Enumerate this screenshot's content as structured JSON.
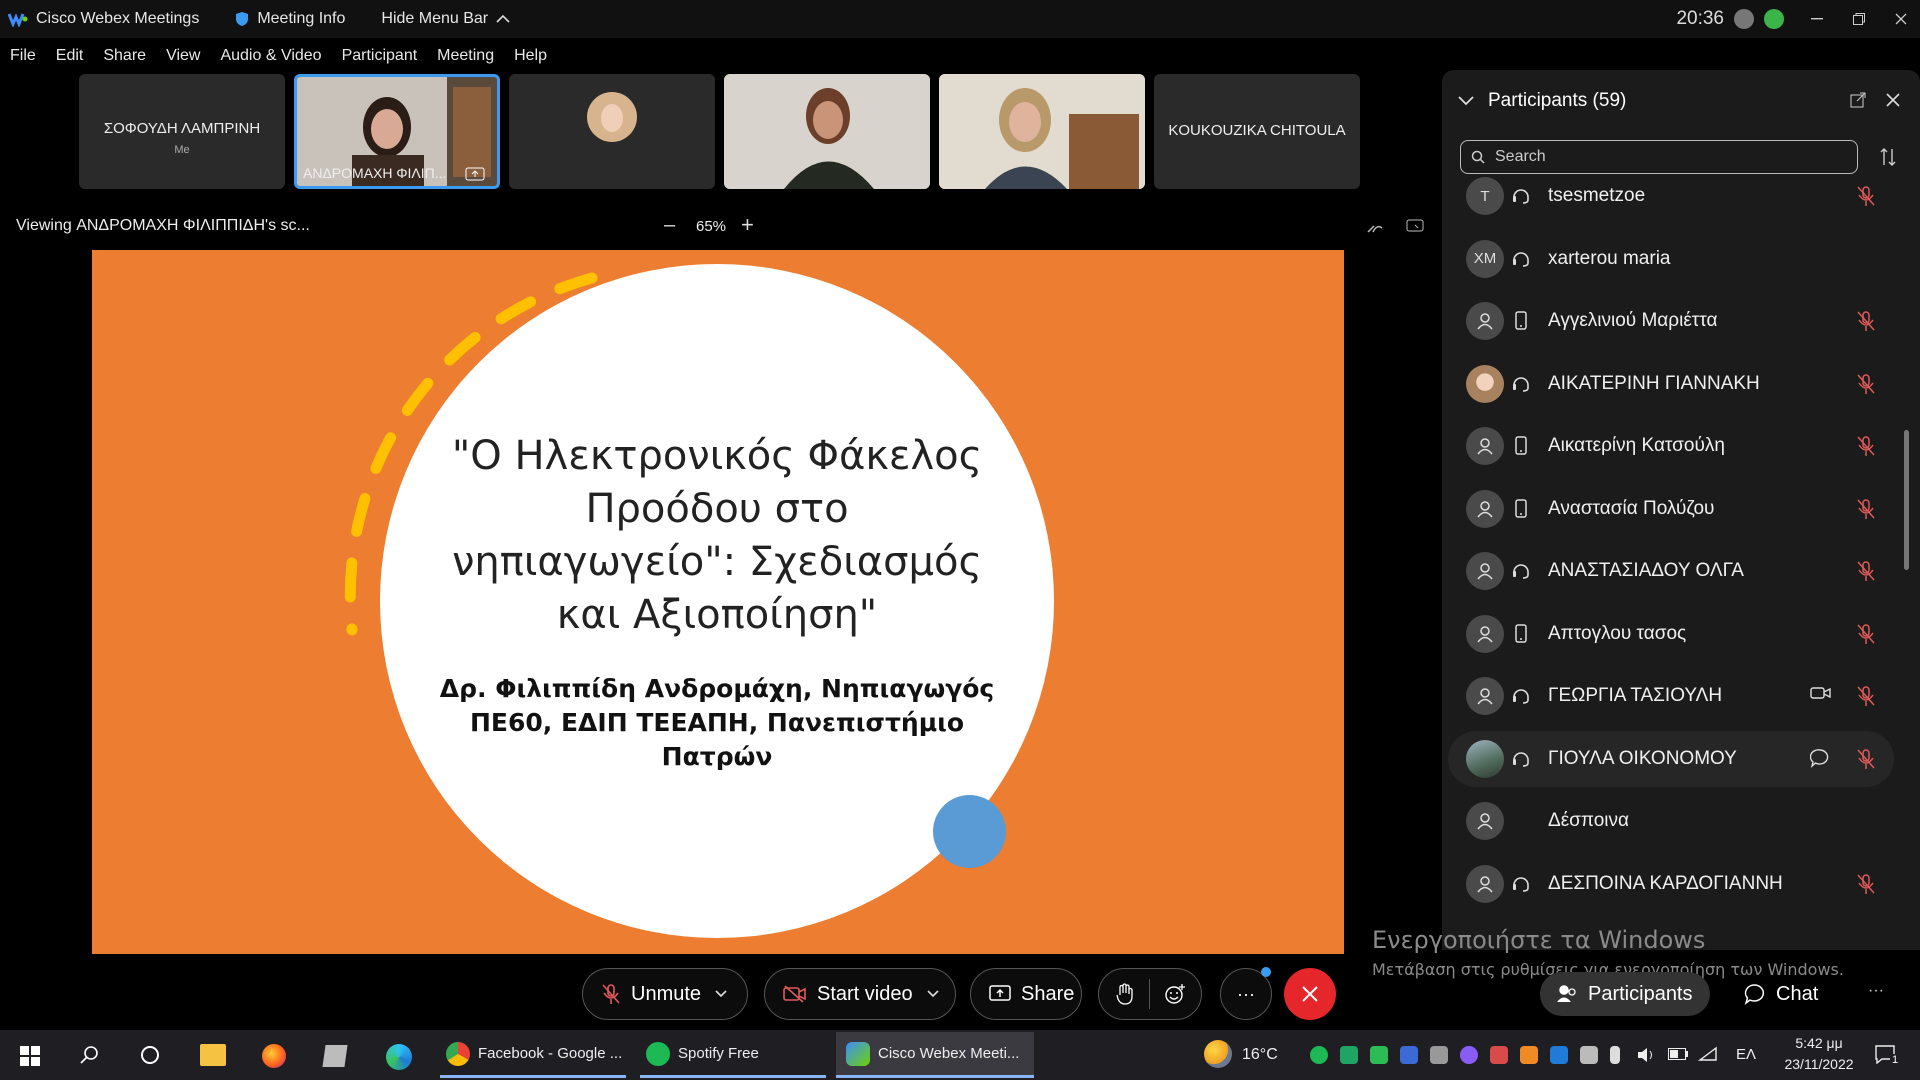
{
  "titlebar": {
    "app_name": "Cisco Webex Meetings",
    "meeting_info": "Meeting Info",
    "hide_menu_bar": "Hide Menu Bar",
    "clock": "20:36"
  },
  "menu": [
    "File",
    "Edit",
    "Share",
    "View",
    "Audio & Video",
    "Participant",
    "Meeting",
    "Help"
  ],
  "video_strip": [
    {
      "name": "ΣΟΦΟΥΔΗ ΛΑΜΠΡΙΝΗ",
      "sub": "Me"
    },
    {
      "name": "ΑΝΔΡΟΜΑΧΗ ΦΙΛΙΠ...",
      "sub": ""
    },
    {
      "name": "",
      "sub": ""
    },
    {
      "name": "",
      "sub": ""
    },
    {
      "name": "",
      "sub": ""
    },
    {
      "name": "KOUKOUZIKA CHITOULA",
      "sub": ""
    }
  ],
  "viewing": {
    "label": "Viewing ΑΝΔΡΟΜΑΧΗ ΦΙΛΙΠΠΙΔΗ's sc...",
    "zoom": "65%"
  },
  "slide": {
    "title": "\"Ο Ηλεκτρονικός Φάκελος Προόδου στο νηπιαγωγείο\": Σχεδιασμός και Αξιοποίηση\"",
    "subtitle": "Δρ. Φιλιππίδη Ανδρομάχη, Νηπιαγωγός ΠΕ60, ΕΔΙΠ ΤΕΕΑΠΗ, Πανεπιστήμιο Πατρών"
  },
  "participants": {
    "header": "Participants (59)",
    "search_placeholder": "Search",
    "list": [
      {
        "initials": "T",
        "name": "tsesmetzoe",
        "device": "headset",
        "muted": true
      },
      {
        "initials": "XM",
        "name": "xarterou maria",
        "device": "headset",
        "muted": false
      },
      {
        "initials": "",
        "name": "Αγγελινιού Μαριέττα",
        "device": "phone",
        "muted": true
      },
      {
        "initials": "",
        "name": "ΑΙΚΑΤΕΡΙΝΗ ΓΙΑΝΝΑΚΗ",
        "device": "headset",
        "muted": true
      },
      {
        "initials": "",
        "name": "Αικατερίνη Κατσούλη",
        "device": "phone",
        "muted": true
      },
      {
        "initials": "",
        "name": "Αναστασία Πολύζου",
        "device": "phone",
        "muted": true
      },
      {
        "initials": "",
        "name": "ΑΝΑΣΤΑΣΙΑΔΟΥ ΟΛΓΑ",
        "device": "headset",
        "muted": true
      },
      {
        "initials": "",
        "name": "Απτογλου τασος",
        "device": "phone",
        "muted": true
      },
      {
        "initials": "",
        "name": "ΓΕΩΡΓΙΑ ΤΑΣΙΟΥΛΗ",
        "device": "headset",
        "muted": true
      },
      {
        "initials": "",
        "name": "ΓΙΟΥΛΑ ΟΙΚΟΝΟΜΟΥ",
        "device": "headset",
        "muted": true
      },
      {
        "initials": "",
        "name": "Δέσποινα",
        "device": "",
        "muted": false
      },
      {
        "initials": "",
        "name": "ΔΕΣΠΟΙΝΑ ΚΑΡΔΟΓΙΑΝΝΗ",
        "device": "headset",
        "muted": true
      }
    ]
  },
  "watermark": {
    "line1": "Ενεργοποιήστε τα Windows",
    "line2": "Μετάβαση στις ρυθμίσεις για ενεργοποίηση των Windows."
  },
  "controls": {
    "unmute": "Unmute",
    "start_video": "Start video",
    "share": "Share",
    "more": "···",
    "participants": "Participants",
    "chat": "Chat",
    "overflow": "···"
  },
  "taskbar": {
    "apps": [
      "Facebook - Google ...",
      "Spotify Free",
      "Cisco Webex Meeti..."
    ],
    "weather": "16°C",
    "lang": "ΕΛ",
    "time": "5:42 μμ",
    "date": "23/11/2022",
    "notifications": "1"
  },
  "colors": {
    "slide_bg": "#ed7d31",
    "accent_blue": "#3b9bf0",
    "end_red": "#e5262a",
    "muted_red": "#e05a5a"
  }
}
